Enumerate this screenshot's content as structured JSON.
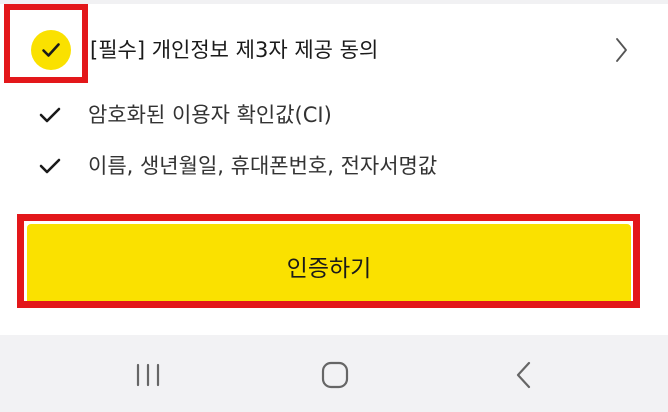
{
  "consent": {
    "title": "[필수] 개인정보 제3자 제공 동의",
    "checked": true,
    "items": [
      {
        "label": "암호화된 이용자 확인값(CI)"
      },
      {
        "label": "이름, 생년월일, 휴대폰번호, 전자서명값"
      }
    ]
  },
  "action": {
    "verify_label": "인증하기"
  },
  "colors": {
    "accent": "#fae100",
    "highlight": "#e3171a",
    "nav_bg": "#f2f2f4"
  },
  "icons": {
    "consent_check": "check-icon",
    "detail": "chevron-right-icon",
    "item_check": "check-icon",
    "nav_recent": "recent-apps-icon",
    "nav_home": "home-icon",
    "nav_back": "back-icon"
  }
}
